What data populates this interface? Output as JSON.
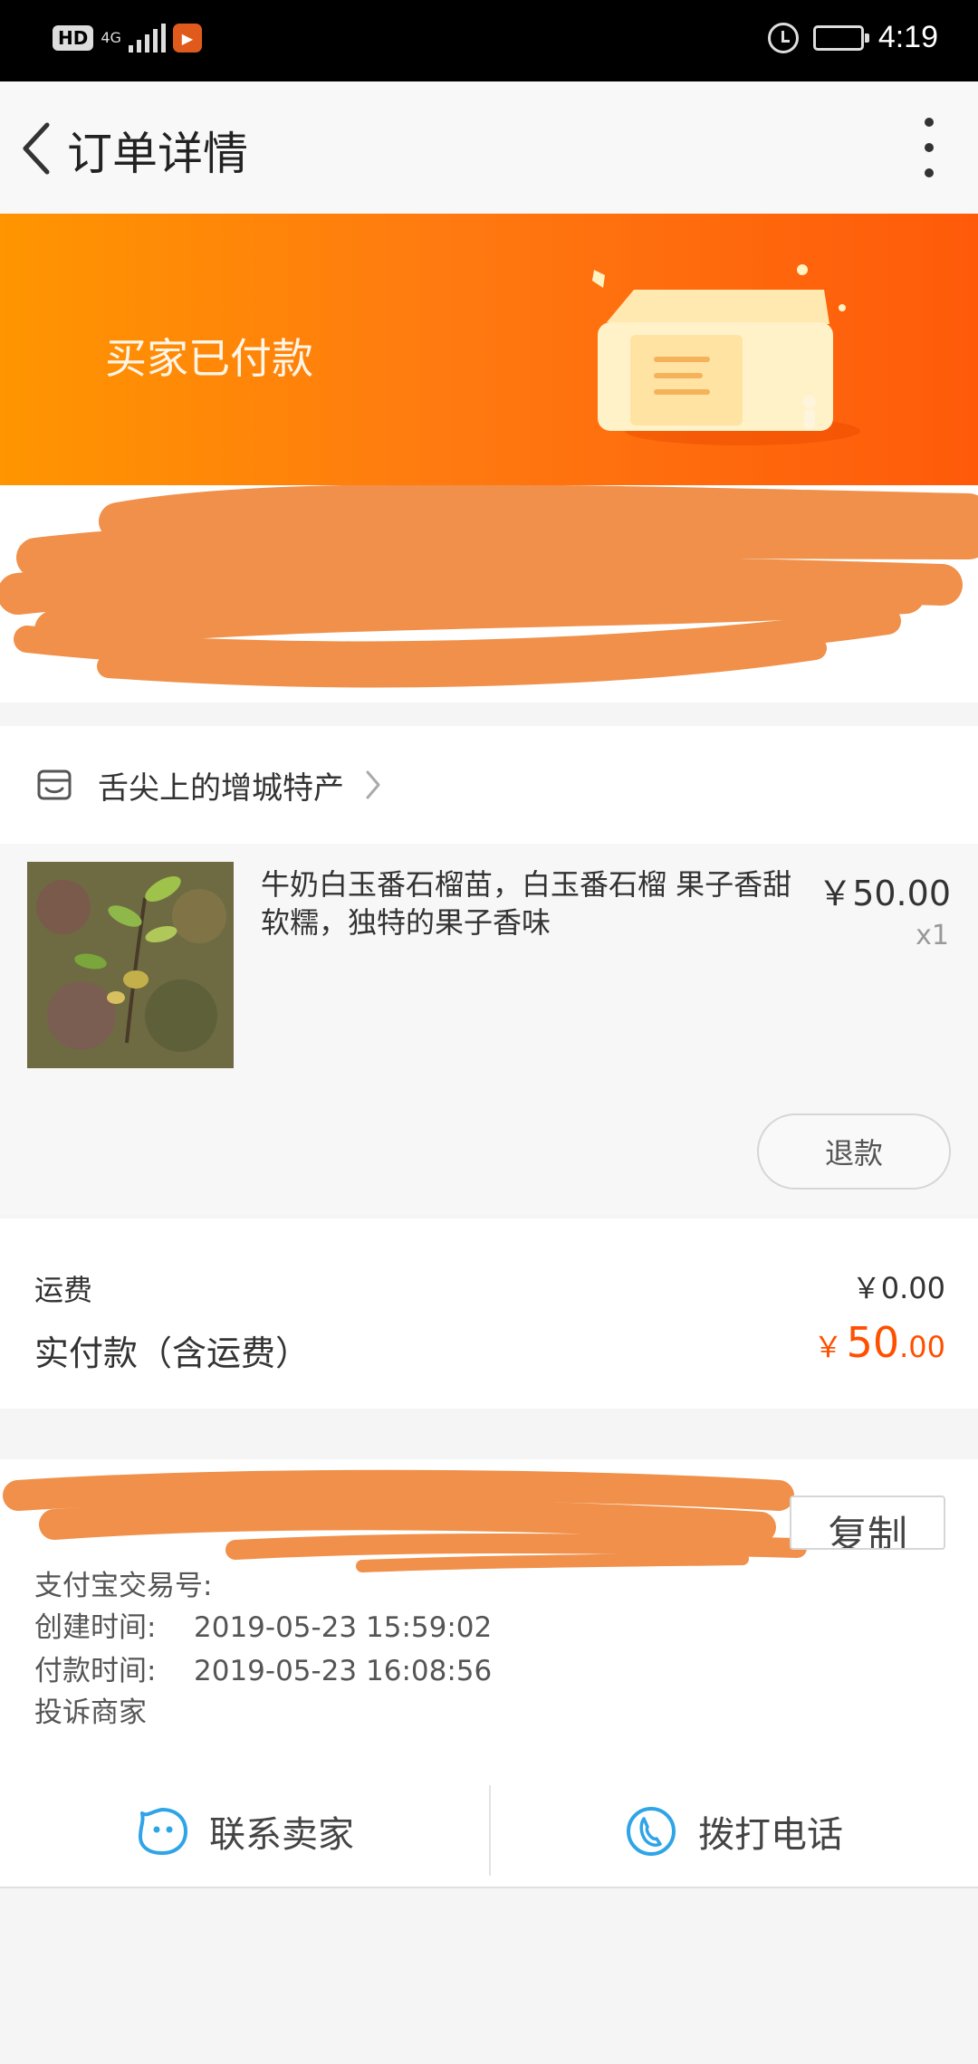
{
  "status_bar": {
    "badge_hd": "HD",
    "network": "4G",
    "time": "4:19"
  },
  "nav": {
    "title": "订单详情"
  },
  "order_status": {
    "text": "买家已付款"
  },
  "shop": {
    "name": "舌尖上的增城特产"
  },
  "product": {
    "title": "牛奶白玉番石榴苗，白玉番石榴 果子香甜软糯，独特的果子香味",
    "price": "￥50.00",
    "quantity": "x1",
    "refund_label": "退款"
  },
  "fees": {
    "shipping_label": "运费",
    "shipping_value": "￥0.00",
    "paid_label": "实付款（含运费）",
    "paid_currency": "￥",
    "paid_integer": "50",
    "paid_decimal": ".00"
  },
  "order_info": {
    "copy_label": "复制",
    "alipay_label": "支付宝交易号:",
    "created_label": "创建时间:",
    "created_value": "2019-05-23 15:59:02",
    "paid_label": "付款时间:",
    "paid_value": "2019-05-23 16:08:56",
    "complain_label": "投诉商家"
  },
  "actions": {
    "contact_seller": "联系卖家",
    "call_phone": "拨打电话"
  },
  "colors": {
    "accent": "#ff5000",
    "banner_start": "#ff9500",
    "banner_end": "#ff5a0a",
    "redaction": "#f0904a",
    "icon_blue": "#2fa4e7"
  }
}
